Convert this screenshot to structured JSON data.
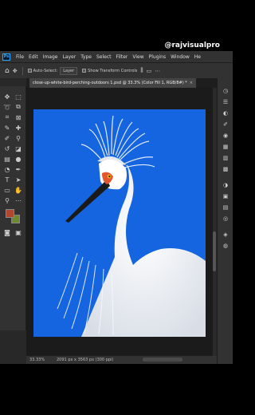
{
  "watermark": "@rajvisualpro",
  "app": {
    "logo": "Ps",
    "menu": [
      "File",
      "Edit",
      "Image",
      "Layer",
      "Type",
      "Select",
      "Filter",
      "View",
      "Plugins",
      "Window",
      "He"
    ]
  },
  "options": {
    "auto_select_label": "Auto-Select:",
    "auto_select_value": "Layer",
    "transform_label": "Show Transform Controls"
  },
  "document": {
    "tab_title": "close-up-white-bird-perching-outdoors 1.psd @ 33.3% (Color Fill 1, RGB/8#) *",
    "close_glyph": "×",
    "background_color": "#1565e0"
  },
  "status": {
    "zoom": "33.33%",
    "dimensions": "2091 px x 3563 px (300 ppi)"
  },
  "colors": {
    "foreground": "#b1462e",
    "background": "#6c8b2e",
    "app_bg": "#282828",
    "panel_bg": "#323232"
  },
  "tools": [
    "move-tool",
    "marquee-tool",
    "lasso-tool",
    "object-select-tool",
    "crop-tool",
    "frame-tool",
    "eyedropper-tool",
    "healing-tool",
    "brush-tool",
    "clone-stamp-tool",
    "history-brush-tool",
    "eraser-tool",
    "gradient-tool",
    "blur-tool",
    "dodge-tool",
    "pen-tool",
    "type-tool",
    "path-select-tool",
    "shape-tool",
    "hand-tool",
    "zoom-tool"
  ]
}
